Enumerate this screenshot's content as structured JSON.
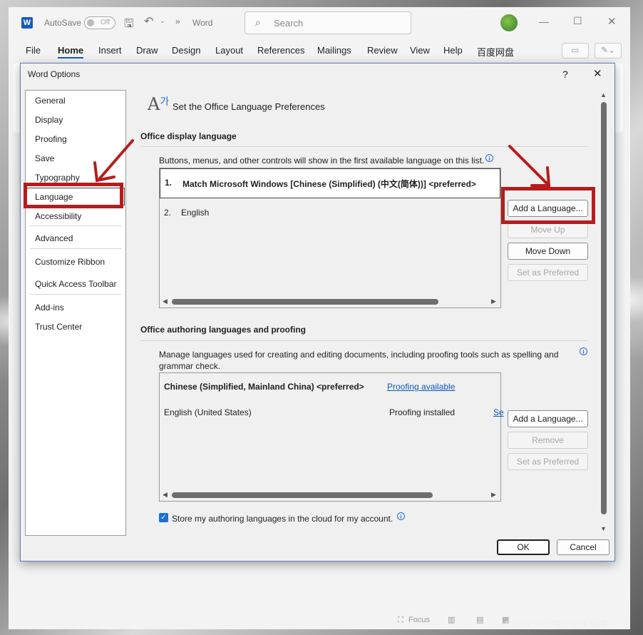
{
  "titlebar": {
    "autosave_label": "AutoSave",
    "autosave_state": "Off",
    "app_name": "Word",
    "search_placeholder": "Search"
  },
  "menu": [
    "File",
    "Home",
    "Insert",
    "Draw",
    "Design",
    "Layout",
    "References",
    "Mailings",
    "Review",
    "View",
    "Help",
    "百度网盘"
  ],
  "dialog": {
    "title": "Word Options",
    "help": "?",
    "close": "✕",
    "nav": [
      "General",
      "Display",
      "Proofing",
      "Save",
      "Typography",
      "Language",
      "Accessibility",
      "Advanced",
      "Customize Ribbon",
      "Quick Access Toolbar",
      "Add-ins",
      "Trust Center"
    ],
    "selected_nav": "Language",
    "heading": "Set the Office Language Preferences",
    "display_section": {
      "title": "Office display language",
      "description": "Buttons, menus, and other controls will show in the first available language on this list.",
      "items": [
        {
          "num": "1.",
          "label": "Match Microsoft Windows [Chinese (Simplified) (中文(简体))] <preferred>"
        },
        {
          "num": "2.",
          "label": "English"
        }
      ],
      "buttons": {
        "add": "Add a Language...",
        "move_up": "Move Up",
        "move_down": "Move Down",
        "set_preferred": "Set as Preferred"
      }
    },
    "authoring_section": {
      "title": "Office authoring languages and proofing",
      "description": "Manage languages used for creating and editing documents, including proofing tools such as spelling and grammar check.",
      "rows": [
        {
          "language": "Chinese (Simplified, Mainland China) <preferred>",
          "status": "Proofing available",
          "extra": ""
        },
        {
          "language": "English (United States)",
          "status": "Proofing installed",
          "extra": "Se"
        }
      ],
      "buttons": {
        "add": "Add a Language...",
        "remove": "Remove",
        "set_preferred": "Set as Preferred"
      }
    },
    "cloud_checkbox": {
      "label": "Store my authoring languages in the cloud for my account.",
      "checked": true
    },
    "ok": "OK",
    "cancel": "Cancel"
  },
  "statusbar": {
    "focus": "Focus"
  },
  "watermark": "CSDN @程序小白学程序",
  "colors": {
    "accent": "#185abd",
    "highlight": "#b71c1c",
    "link": "#0a58b8"
  }
}
